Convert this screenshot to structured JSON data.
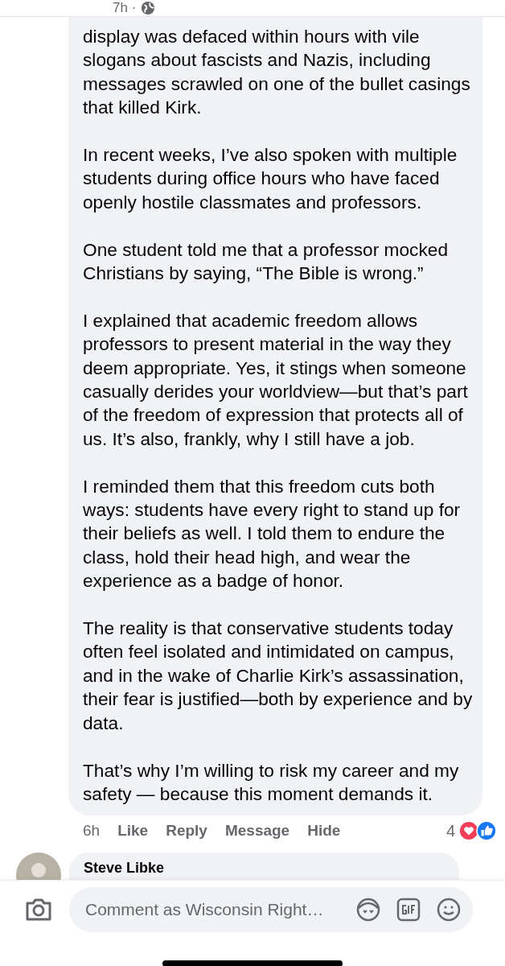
{
  "post_meta": {
    "time": "7h ·"
  },
  "comment": {
    "paragraphs": [
      "display was defaced within hours with vile slogans about fascists and Nazis, including messages scrawled on one of the bullet casings that killed Kirk.",
      "In recent weeks, I’ve also spoken with multiple students during office hours who have faced openly hostile classmates and professors.",
      "One student told me that a professor mocked Christians by saying, “The Bible is wrong.”",
      "I explained that academic freedom allows professors to present material in the way they deem appropriate. Yes, it stings when someone casually derides your worldview—but that’s part of the freedom of expression that protects all of us. It’s also, frankly, why I still have a job.",
      "I reminded them that this freedom cuts both ways: students have every right to stand up for their beliefs as well. I told them to endure the class, hold their head high, and wear the experience as a badge of honor.",
      "The reality is that conservative students today often feel isolated and intimidated on campus, and in the wake of Charlie Kirk’s assassination, their fear is justified—both by experience and by data.",
      "That’s why I’m willing to risk my career and my safety — because this moment demands it."
    ],
    "time": "6h",
    "actions": [
      "Like",
      "Reply",
      "Message",
      "Hide"
    ],
    "reaction_count": "4"
  },
  "next_comment": {
    "author": "Steve Libke"
  },
  "composer": {
    "placeholder": "Comment as Wisconsin Right…"
  }
}
